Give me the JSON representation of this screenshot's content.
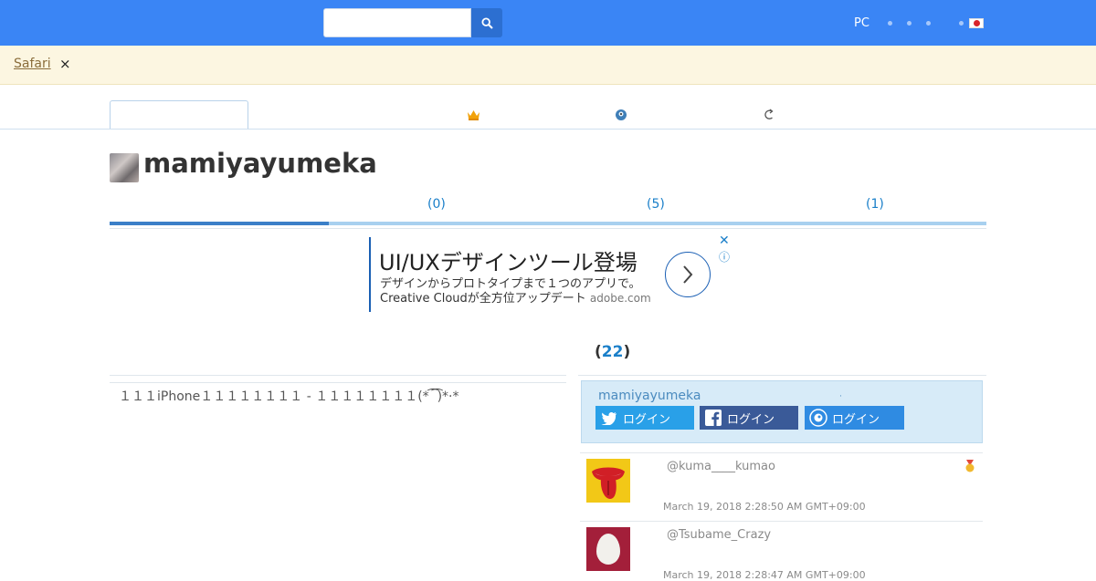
{
  "header": {
    "search": {
      "placeholder": "",
      "value": ""
    },
    "right_label": "PC"
  },
  "banner": {
    "link_label": "Safari",
    "close_label": "×"
  },
  "nav": {
    "icons": [
      "crown-icon",
      "bird-icon",
      "refresh-icon"
    ]
  },
  "profile": {
    "username": "mamiyayumeka"
  },
  "subtabs": [
    {
      "label": "(0)"
    },
    {
      "label": "(5)"
    },
    {
      "label": "(1)"
    }
  ],
  "ad": {
    "title": "UI/UXデザインツール登場",
    "line1": "デザインからプロトタイプまで１つのアプリで。",
    "line2": "Creative Cloudが全方位アップデート",
    "domain": "adobe.com",
    "close": "✕",
    "info": "ⓘ"
  },
  "left": {
    "text": "１１１iPhone１１１１１１１１ - １１１１１１１１(* ͡ ͡)*·*"
  },
  "right": {
    "count_open": "(",
    "count": "22",
    "count_close": ")",
    "login_box": {
      "user": "mamiyayumeka",
      "dot": "·",
      "buttons": [
        {
          "label": "ログイン",
          "service": "twitter"
        },
        {
          "label": "ログイン",
          "service": "facebook"
        },
        {
          "label": "ログイン",
          "service": "other"
        }
      ]
    },
    "items": [
      {
        "user": "@kuma____kumao",
        "date": "March 19, 2018 2:28:50 AM GMT+09:00"
      },
      {
        "user": "@Tsubame_Crazy",
        "date": "March 19, 2018 2:28:47 AM GMT+09:00"
      }
    ]
  },
  "colors": {
    "topbar": "#3a85f5",
    "banner": "#fcf6e1",
    "link": "#1a7fc9",
    "twitter": "#29a0e8",
    "facebook": "#3a5a98"
  }
}
